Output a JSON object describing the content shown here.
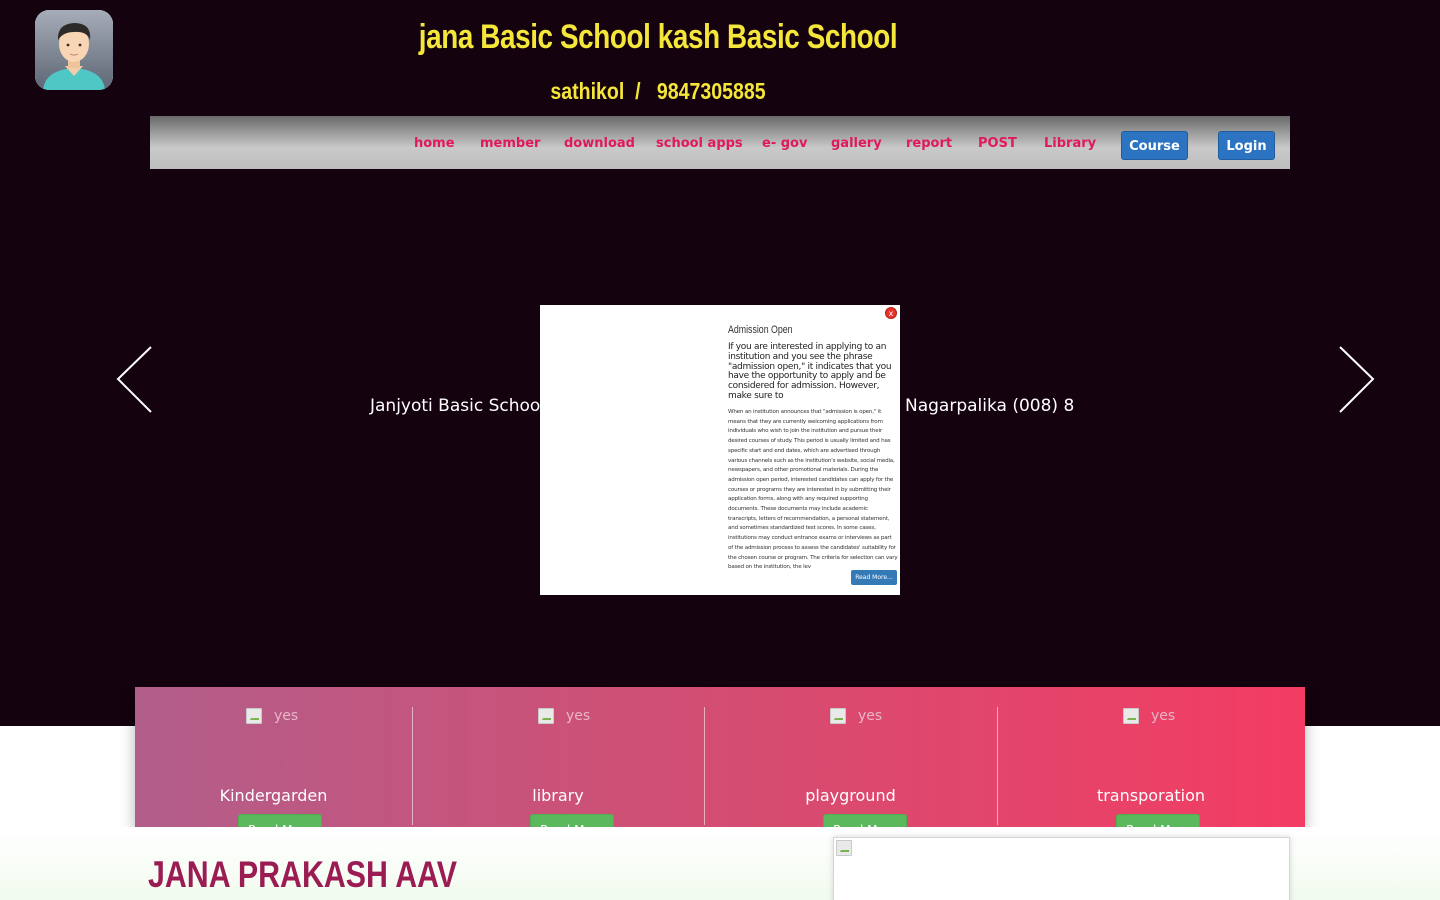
{
  "header": {
    "title": "jana Basic School kash Basic School",
    "contact": "sathikol  /   9847305885"
  },
  "nav": {
    "links": [
      "home",
      "member",
      "download",
      "school apps",
      "e- gov",
      "gallery",
      "report",
      "POST",
      "Library"
    ],
    "course_button": "Course",
    "login_button": "Login"
  },
  "carousel": {
    "caption_left": "Janjyoti Basic Schoo",
    "caption_right": "Nagarpalika (008) 8"
  },
  "modal": {
    "close_label": "x",
    "title": "Admission Open",
    "lead": "If you are interested in applying to an institution and you see the phrase \"admission open,\" it indicates that you have the opportunity to apply and be considered for admission. However, make sure to",
    "body": "When an institution announces that \"admission is open,\" it means that they are currently welcoming applications from individuals who wish to join the institution and pursue their desired courses of study. This period is usually limited and has specific start and end dates, which are advertised through various channels such as the institution's website, social media, newspapers, and other promotional materials. During the admission open period, interested candidates can apply for the courses or programs they are interested in by submitting their application forms, along with any required supporting documents. These documents may include academic transcripts, letters of recommendation, a personal statement, and sometimes standardized test scores. In some cases, institutions may conduct entrance exams or interviews as part of the admission process to assess the candidates' suitability for the chosen course or program. The criteria for selection can vary based on the institution, the lev",
    "read_more": "Read More..."
  },
  "features": {
    "items": [
      {
        "image_alt": "yes",
        "title": "Kindergarden",
        "button": "Read More"
      },
      {
        "image_alt": "yes",
        "title": "library",
        "button": "Read More"
      },
      {
        "image_alt": "yes",
        "title": "playground",
        "button": "Read More"
      },
      {
        "image_alt": "yes",
        "title": "transporation",
        "button": "Read More"
      }
    ]
  },
  "bottom": {
    "title": "JANA PRAKASH AAV"
  },
  "colors": {
    "hero_bg": "#14020e",
    "title_yellow": "#f5e63a",
    "nav_link": "#e0195a",
    "nav_button": "#2c74c2",
    "feature_btn": "#5cb85c",
    "bottom_title": "#9b1c52"
  }
}
